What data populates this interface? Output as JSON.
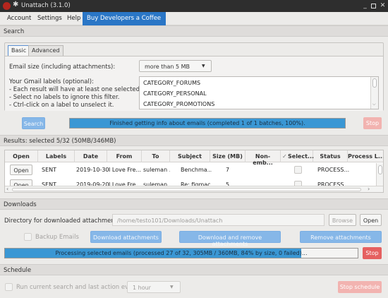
{
  "window": {
    "title": "Unattach (3.1.0)"
  },
  "menu": {
    "items": [
      "Account",
      "Settings",
      "Help"
    ],
    "highlight": "Buy Developers a Coffee"
  },
  "search_section": {
    "header": "Search",
    "tabs": [
      "Basic",
      "Advanced"
    ],
    "email_size_label": "Email size (including attachments):",
    "email_size_value": "more than 5 MB",
    "labels_help": [
      "Your Gmail labels (optional):",
      "- Each result will have at least one selected label.",
      "- Select no labels to ignore this filter.",
      "- Ctrl-click on a label to unselect it."
    ],
    "labels_list": [
      "CATEGORY_FORUMS",
      "CATEGORY_PERSONAL",
      "CATEGORY_PROMOTIONS"
    ],
    "search_button": "Search",
    "progress_text": "Finished getting info about emails (completed 1 of 1 batches, 100%).",
    "progress": 1.0,
    "stop_button": "Stop"
  },
  "results": {
    "header": "Results: selected 5/32 (50MB/346MB)",
    "columns": [
      "Open",
      "Labels",
      "Date",
      "From",
      "To",
      "Subject",
      "Size (MB)",
      "Non-emb...",
      "Select...",
      "Status",
      "Process L..."
    ],
    "rows": [
      {
        "open": "Open",
        "labels": "SENT",
        "date": "2019-10-30",
        "from": "I Love Fre...",
        "to": "suleman ...",
        "subject": "Benchma...",
        "size": "7",
        "status": "PROCESS..."
      },
      {
        "open": "Open",
        "labels": "SENT",
        "date": "2019-09-20",
        "from": "I Love Fre...",
        "to": "suleman ...",
        "subject": "Re: figmac...",
        "size": "5",
        "status": "PROCESS..."
      }
    ]
  },
  "downloads": {
    "header": "Downloads",
    "directory_label": "Directory for downloaded attachments:",
    "directory_value": "/home/testo101/Downloads/Unattach",
    "browse_button": "Browse",
    "open_button": "Open",
    "backup_label": "Backup Emails",
    "download_button": "Download attachments",
    "download_remove_button": "Download and remove attachments",
    "remove_button": "Remove attachments",
    "progress_text": "Processing selected emails (processed 27 of 32, 305MB / 360MB, 84% by size, 0 failed)...",
    "progress": 0.84,
    "stop_button": "Stop"
  },
  "schedule": {
    "header": "Schedule",
    "run_label": "Run current search and last action every",
    "interval_value": "1 hour",
    "stop_button": "Stop schedule"
  },
  "colors": {
    "accent": "#2a76c6",
    "progress": "#3a97d4",
    "stop": "#e56060"
  }
}
